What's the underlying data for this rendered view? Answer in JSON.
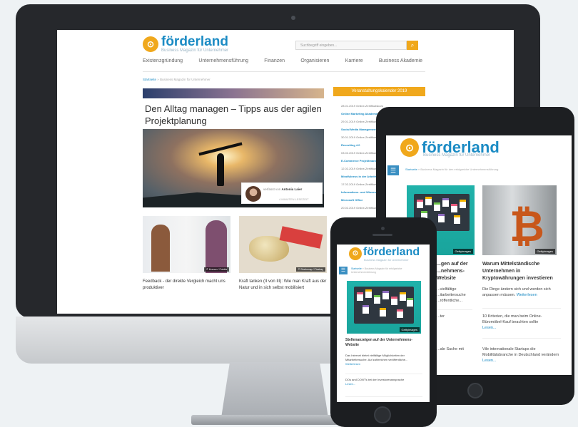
{
  "desktop": {
    "brand": {
      "name": "förderland",
      "tagline": "Business Magazin für Unternehmer",
      "logo_icon": "förderland-logo-icon"
    },
    "search": {
      "placeholder": "Suchbegriff eingeben...",
      "button_icon": "search-icon"
    },
    "nav": [
      "Existenzgründung",
      "Unternehmensführung",
      "Finanzen",
      "Organisieren",
      "Karriere",
      "Business Akademie"
    ],
    "breadcrumb": {
      "home": "Startseite",
      "rest": "» Business Magazin für Unternehmer"
    },
    "article": {
      "title": "Den Alltag managen – Tipps aus der agilen Projektplanung",
      "author_prefix": "verfasst von",
      "author": "Antonia Laier",
      "read_time": "4 MINUTEN LESEZEIT"
    },
    "cards": [
      {
        "title": "Feedback - der direkte Vergleich macht uns produktiver",
        "credit": "© Kzenon / Fotolia"
      },
      {
        "title": "Kraft tanken (II von III): Wie man Kraft aus der Natur und in sich selbst mobilisiert",
        "credit": "© Stocksnap / Pixabay"
      }
    ],
    "events": {
      "heading": "Veranstaltungskalender 2019",
      "items": [
        {
          "text": "28.01.2019 Online-Zertifikatskurs",
          "link": false
        },
        {
          "text": "Online Marketing Akademie",
          "link": true
        },
        {
          "text": "29.01.2019 Online-Zertifikatskurs",
          "link": false
        },
        {
          "text": "Social Media Management",
          "link": true
        },
        {
          "text": "30.01.2019 Online-Zertifikatskurs",
          "link": false
        },
        {
          "text": "Recruiting 4.0",
          "link": true
        },
        {
          "text": "03.02.2019 Online-Zertifikatskurs",
          "link": false
        },
        {
          "text": "E-Commerce Projektmanagement",
          "link": true
        },
        {
          "text": "12.02.2019 Online-Zertifikatskurs",
          "link": false
        },
        {
          "text": "Mindfulness in der Arbeitswelt",
          "link": true
        },
        {
          "text": "17.02.2019 Online-Zertifikatskurs",
          "link": false
        },
        {
          "text": "Informations- und Wissensmanagement mit",
          "link": true
        },
        {
          "text": "Microsoft Office",
          "link": true
        },
        {
          "text": "20.02.2019 Online-Zertifikatskurs",
          "link": false
        }
      ]
    }
  },
  "tablet": {
    "brand": {
      "name": "förderland",
      "tagline": "Business Magazin für Unternehmer"
    },
    "breadcrumb": {
      "home": "Startseite",
      "rest": "» Business Magazin für den erfolgreiche Unternehmensführung"
    },
    "image_credit": "Gettyimages",
    "left_col": {
      "title_lines": [
        "...gen auf der",
        "...nehmens-",
        "Website"
      ],
      "text": "...vielfältige ...itarbeitersuche ...röffentliche...",
      "item2": "...ter",
      "item3": "...ale Suche mit"
    },
    "right_col": {
      "title": "Warum Mittelständische Unternehmen in Kryptowährungen investieren",
      "text": "Die Dinge ändern sich und werden sich anpassen müssen.",
      "more": "Weiterlesen",
      "item2": "10 Kriterien, die man beim Online-Büromöbel-Kauf beachten sollte",
      "item2_more": "Lesen...",
      "item3": "Vile internationale Startups die Mobilitätsbranche in Deutschland verändern",
      "item3_more": "Lesen..."
    }
  },
  "phone": {
    "brand": {
      "name": "förderland",
      "tagline": "Business Magazin für Unternehmer"
    },
    "breadcrumb": {
      "home": "Startseite",
      "rest": "» Business Magazin für erfolgreiche Unternehmensführung"
    },
    "image_credit": "Gettyimages",
    "title": "Stellenanzeigen auf der Unternehmens-Website",
    "text": "Das Internet bietet vielfältige Möglichkeiten der Mitarbeitersuche. Auf zahlreichen veröffentliche...",
    "more": "Weiterlesen",
    "item2": "DOs and DON'Ts bei der Investorenansprache",
    "item2_more": "Lesen..."
  },
  "colors": {
    "accent": "#f0a81c",
    "brand": "#1b8bc4",
    "teal": "#20b2aa"
  }
}
